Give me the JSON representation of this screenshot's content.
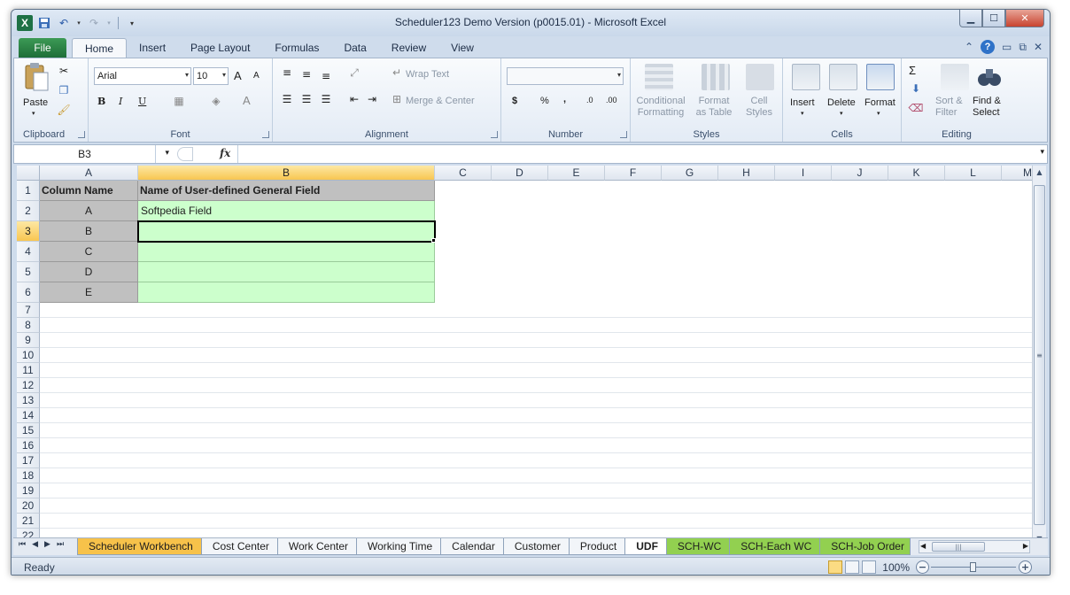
{
  "window": {
    "title": "Scheduler123 Demo Version (p0015.01)  -  Microsoft Excel",
    "logo": "X"
  },
  "ribbon": {
    "file_tab": "File",
    "tabs": [
      "Home",
      "Insert",
      "Page Layout",
      "Formulas",
      "Data",
      "Review",
      "View"
    ],
    "active_tab": "Home",
    "clipboard": {
      "label": "Clipboard",
      "paste": "Paste"
    },
    "font": {
      "label": "Font",
      "name": "Arial",
      "size": "10",
      "bold": "B",
      "italic": "I",
      "underline": "U",
      "grow": "A",
      "shrink": "A",
      "color": "A"
    },
    "alignment": {
      "label": "Alignment",
      "wrap": "Wrap Text",
      "merge": "Merge & Center"
    },
    "number": {
      "label": "Number",
      "currency": "$",
      "percent": "%",
      "comma": ",",
      "inc_dec": ".0",
      "dec_dec": ".00"
    },
    "styles": {
      "label": "Styles",
      "conditional": [
        "Conditional",
        "Formatting"
      ],
      "format_table": [
        "Format",
        "as Table"
      ],
      "cell_styles": [
        "Cell",
        "Styles"
      ]
    },
    "cells": {
      "label": "Cells",
      "insert": "Insert",
      "delete": "Delete",
      "format": "Format"
    },
    "editing": {
      "label": "Editing",
      "sort": [
        "Sort &",
        "Filter"
      ],
      "find": [
        "Find &",
        "Select"
      ],
      "sum": "Σ"
    }
  },
  "formula_bar": {
    "name_box": "B3",
    "fx": "fx",
    "content": ""
  },
  "grid": {
    "columns": [
      "A",
      "B",
      "C",
      "D",
      "E",
      "F",
      "G",
      "H",
      "I",
      "J",
      "K",
      "L",
      "M"
    ],
    "selected_column": "B",
    "rows": [
      "1",
      "2",
      "3",
      "4",
      "5",
      "6",
      "7",
      "8",
      "9",
      "10",
      "11",
      "12",
      "13",
      "14",
      "15",
      "16",
      "17",
      "18",
      "19",
      "20",
      "21",
      "22"
    ],
    "selected_row": "3",
    "header": {
      "a": "Column Name",
      "b": "Name of User-defined General Field"
    },
    "records": [
      {
        "key": "A",
        "value": "Softpedia Field"
      },
      {
        "key": "B",
        "value": ""
      },
      {
        "key": "C",
        "value": ""
      },
      {
        "key": "D",
        "value": ""
      },
      {
        "key": "E",
        "value": ""
      }
    ]
  },
  "sheets": {
    "tabs": [
      "Scheduler Workbench",
      "Cost Center",
      "Work Center",
      "Working Time",
      "Calendar",
      "Customer",
      "Product",
      "UDF",
      "SCH-WC",
      "SCH-Each WC",
      "SCH-Job Order"
    ],
    "active": "UDF",
    "colors": {
      "Scheduler Workbench": "#f7c24a",
      "SCH-WC": "#92d050",
      "SCH-Each WC": "#92d050",
      "SCH-Job Order": "#92d050"
    }
  },
  "status": {
    "mode": "Ready",
    "zoom": "100%",
    "zoom_percent": 100
  }
}
